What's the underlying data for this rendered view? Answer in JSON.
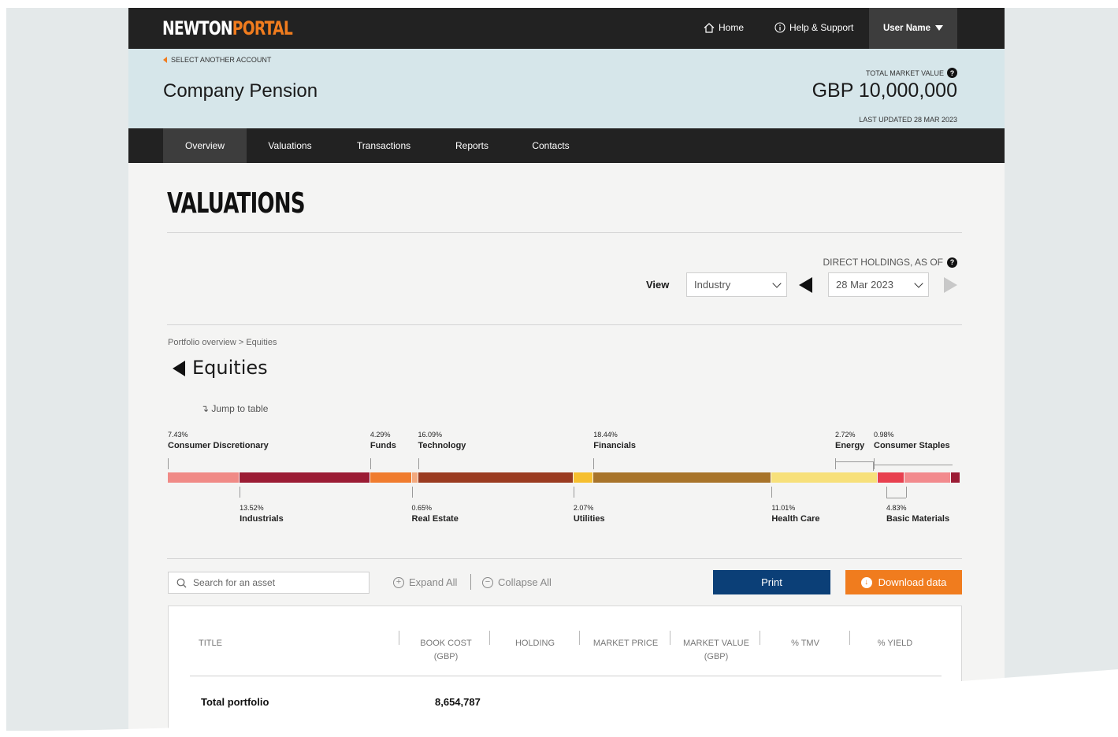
{
  "brand": {
    "part1": "NEWTON",
    "part2": "PORTAL"
  },
  "topnav": {
    "home": "Home",
    "help": "Help & Support",
    "user": "User Name"
  },
  "account": {
    "select_another": "SELECT ANOTHER ACCOUNT",
    "name": "Company Pension",
    "tmv_label": "TOTAL MARKET VALUE",
    "tmv_value": "GBP 10,000,000",
    "last_updated": "LAST UPDATED 28 MAR 2023"
  },
  "subnav": [
    "Overview",
    "Valuations",
    "Transactions",
    "Reports",
    "Contacts"
  ],
  "page_title": "VALUATIONS",
  "controls": {
    "direct_holdings_label": "DIRECT HOLDINGS, AS OF",
    "view_label": "View",
    "view_value": "Industry",
    "date_value": "28 Mar 2023"
  },
  "breadcrumb": "Portfolio overview > Equities",
  "section_title": "Equities",
  "jump_link": "Jump to table",
  "chart_data": {
    "type": "bar",
    "orientation": "horizontal-stacked",
    "categories": [
      "Consumer Discretionary",
      "Industrials",
      "Funds",
      "Real Estate",
      "Technology",
      "Utilities",
      "Financials",
      "Health Care",
      "Energy",
      "Basic Materials",
      "Consumer Staples"
    ],
    "labels": [
      "7.43%",
      "13.52%",
      "4.29%",
      "0.65%",
      "16.09%",
      "2.07%",
      "18.44%",
      "11.01%",
      "2.72%",
      "4.83%",
      "0.98%"
    ],
    "values": [
      7.43,
      13.52,
      4.29,
      0.65,
      16.09,
      2.07,
      18.44,
      11.01,
      2.72,
      4.83,
      0.98
    ],
    "colors": [
      "#f08a86",
      "#9b1c34",
      "#f07c2e",
      "#f3a97e",
      "#9a3b20",
      "#f6bf2f",
      "#a8742a",
      "#f7e07a",
      "#e8404f",
      "#f28a8d",
      "#9b1c34"
    ],
    "label_positions": [
      "top",
      "bottom",
      "top",
      "bottom",
      "top",
      "bottom",
      "top",
      "bottom",
      "top",
      "bottom",
      "top"
    ]
  },
  "toolbar": {
    "search_placeholder": "Search for an asset",
    "expand_all": "Expand All",
    "collapse_all": "Collapse All",
    "print": "Print",
    "download": "Download data"
  },
  "table": {
    "columns": [
      {
        "line1": "TITLE",
        "line2": ""
      },
      {
        "line1": "BOOK COST",
        "line2": "(GBP)"
      },
      {
        "line1": "HOLDING",
        "line2": ""
      },
      {
        "line1": "MARKET PRICE",
        "line2": ""
      },
      {
        "line1": "MARKET VALUE",
        "line2": "(GBP)"
      },
      {
        "line1": "% TMV",
        "line2": ""
      },
      {
        "line1": "% YIELD",
        "line2": ""
      }
    ],
    "total_row": {
      "title": "Total portfolio",
      "book_cost": "8,654,787"
    }
  }
}
